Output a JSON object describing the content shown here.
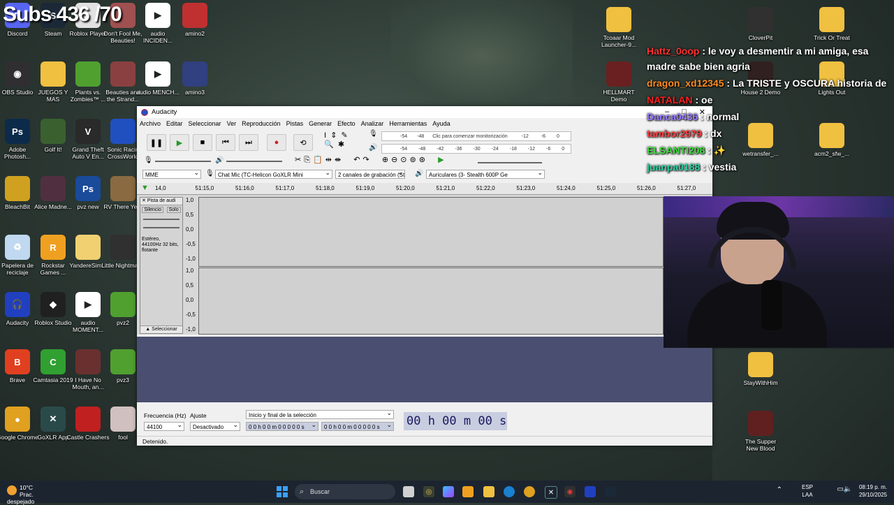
{
  "overlay_text": "Subs 436 /70",
  "desktop_icons": [
    {
      "label": "Discord",
      "color": "#5865f2",
      "glyph": "D"
    },
    {
      "label": "Steam",
      "color": "#1b2838",
      "glyph": "S"
    },
    {
      "label": "Roblox Player",
      "color": "#e2e2e2",
      "glyph": "R"
    },
    {
      "label": "Don't Fool Me, Beauties!",
      "color": "#a05050",
      "glyph": ""
    },
    {
      "label": "audio INCIDEN...",
      "color": "#ffffff",
      "glyph": "▶"
    },
    {
      "label": "amino2",
      "color": "#c03030",
      "glyph": ""
    },
    {
      "label": "OBS Studio",
      "color": "#302e31",
      "glyph": "◉"
    },
    {
      "label": "JUEGOS Y MAS",
      "color": "#f0c040",
      "glyph": ""
    },
    {
      "label": "Plants vs. Zombies™ ...",
      "color": "#50a030",
      "glyph": ""
    },
    {
      "label": "Beauties and the Strand...",
      "color": "#8a4040",
      "glyph": ""
    },
    {
      "label": "audio MENCH...",
      "color": "#ffffff",
      "glyph": "▶"
    },
    {
      "label": "amino3",
      "color": "#304080",
      "glyph": ""
    },
    {
      "label": "Adobe Photosh...",
      "color": "#0c2b4a",
      "glyph": "Ps"
    },
    {
      "label": "Golf It!",
      "color": "#3a6030",
      "glyph": ""
    },
    {
      "label": "Grand Theft Auto V En...",
      "color": "#2a2a2a",
      "glyph": "V"
    },
    {
      "label": "Sonic Racin CrossWorld",
      "color": "#2050c0",
      "glyph": ""
    },
    {
      "label": "BleachBit",
      "color": "#d0a020",
      "glyph": ""
    },
    {
      "label": "Alice Madne...",
      "color": "#503040",
      "glyph": ""
    },
    {
      "label": "pvz new",
      "color": "#1a4a9a",
      "glyph": "Ps"
    },
    {
      "label": "RV There Ye...",
      "color": "#8a6a40",
      "glyph": ""
    },
    {
      "label": "Papelera de reciclaje",
      "color": "#c0d8f0",
      "glyph": "♻"
    },
    {
      "label": "Rockstar Games ...",
      "color": "#f0a020",
      "glyph": "R"
    },
    {
      "label": "YandereSim...",
      "color": "#f0d070",
      "glyph": ""
    },
    {
      "label": "Little Nightmar...",
      "color": "#303030",
      "glyph": ""
    },
    {
      "label": "Audacity",
      "color": "#2040c0",
      "glyph": "🎧"
    },
    {
      "label": "Roblox Studio",
      "color": "#202020",
      "glyph": "◆"
    },
    {
      "label": "audio MOMENT...",
      "color": "#ffffff",
      "glyph": "▶"
    },
    {
      "label": "pvz2",
      "color": "#50a030",
      "glyph": ""
    },
    {
      "label": "Brave",
      "color": "#e04020",
      "glyph": "B"
    },
    {
      "label": "Camtasia 2019",
      "color": "#30a030",
      "glyph": "C"
    },
    {
      "label": "I Have No Mouth, an...",
      "color": "#6a3030",
      "glyph": ""
    },
    {
      "label": "pvz3",
      "color": "#50a030",
      "glyph": ""
    },
    {
      "label": "Google Chrome",
      "color": "#e0a020",
      "glyph": "●"
    },
    {
      "label": "GoXLR App",
      "color": "#2a4a4a",
      "glyph": "✕"
    },
    {
      "label": "Castle Crashers",
      "color": "#c02020",
      "glyph": ""
    },
    {
      "label": "fool",
      "color": "#d0c0c0",
      "glyph": ""
    }
  ],
  "right_icons": [
    {
      "label": "Tcoaar Mod Launcher-9...",
      "color": "#f0c040"
    },
    {
      "label": "CloverPit",
      "color": "#303030"
    },
    {
      "label": "Trick Or Treat",
      "color": "#f0c040"
    },
    {
      "label": "HELLMART Demo",
      "color": "#6a2020"
    },
    {
      "label": "House 2 Demo",
      "color": "#302020"
    },
    {
      "label": "Lights Out",
      "color": "#f0c040"
    },
    {
      "label": "wetransfer_...",
      "color": "#f0c040"
    },
    {
      "label": "acm2_sfw_...",
      "color": "#f0c040"
    },
    {
      "label": "StayWithHim",
      "color": "#f0c040"
    },
    {
      "label": "The Supper New Blood",
      "color": "#602020"
    }
  ],
  "audacity": {
    "title": "Audacity",
    "menu": [
      "Archivo",
      "Editar",
      "Seleccionar",
      "Ver",
      "Reproducción",
      "Pistas",
      "Generar",
      "Efecto",
      "Analizar",
      "Herramientas",
      "Ayuda"
    ],
    "meter_hint": "Clic para comenzar monitorización",
    "meter_scale": [
      "-54",
      "-48",
      "-12",
      "-6",
      "0"
    ],
    "meter_scale2": [
      "-54",
      "-48",
      "-42",
      "-36",
      "-30",
      "-24",
      "-18",
      "-12",
      "-6",
      "0"
    ],
    "host": "MME",
    "input_device": "Chat Mic (TC-Helicon GoXLR Mini",
    "channels": "2 canales de grabación (Ster",
    "output_device": "Auriculares (3- Stealth 600P Ge",
    "ruler": [
      "14,0",
      "51:15,0",
      "51:16,0",
      "51:17,0",
      "51:18,0",
      "51:19,0",
      "51:20,0",
      "51:21,0",
      "51:22,0",
      "51:23,0",
      "51:24,0",
      "51:25,0",
      "51:26,0",
      "51:27,0"
    ],
    "track": {
      "name": "Pista de audi",
      "mute": "Silencio",
      "solo": "Solo",
      "info": "Estéreo, 44100Hz 32 bits, flotante",
      "select": "Seleccionar",
      "scale": [
        "1,0",
        "0,5",
        "0,0",
        "-0,5",
        "-1,0"
      ]
    },
    "bottom": {
      "rate_label": "Frecuencia (Hz)",
      "snap_label": "Ajuste",
      "rate_value": "44100",
      "snap_value": "Desactivado",
      "selection_mode": "Inicio y final de la selección",
      "sel_start": "0 0 h 0 0 m 0 0 0 0 0 s",
      "sel_end": "0 0 h 0 0 m 0 0 0 0 0 s",
      "time": "00 h 00 m 00 s"
    },
    "status": "Detenido."
  },
  "chat": [
    {
      "user": "Hattz_0oop",
      "color": "#ff3030",
      "text": "le voy a desmentir a mi amiga, esa madre sabe bien agria"
    },
    {
      "user": "dragon_xd12345",
      "color": "#ff8c20",
      "text": "La TRISTE y OSCURA historia de"
    },
    {
      "user": "NATALAN",
      "color": "#ff2020",
      "text": "oe"
    },
    {
      "user": "Danca0436",
      "color": "#9a7aff",
      "text": "normal"
    },
    {
      "user": "tambor2979",
      "color": "#ff4040",
      "text": "dx"
    },
    {
      "user": "ELSANTI208",
      "color": "#40e040",
      "text": "✨"
    },
    {
      "user": "juanpa0188",
      "color": "#30d0a0",
      "text": "vestia"
    }
  ],
  "taskbar": {
    "temp": "10°C",
    "weather": "Prac. despejado",
    "search": "Buscar",
    "lang1": "ESP",
    "lang2": "LAA",
    "time": "08:19 p. m.",
    "date": "29/10/2025"
  }
}
